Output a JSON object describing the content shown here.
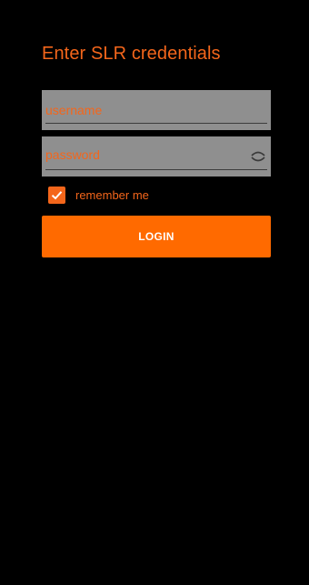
{
  "login_form": {
    "title": "Enter SLR credentials",
    "username": {
      "value": "",
      "placeholder": "username"
    },
    "password": {
      "value": "",
      "placeholder": "password",
      "toggle_icon": "eye-toggle-icon"
    },
    "remember": {
      "checked": true,
      "label": "remember me"
    },
    "login_button_label": "LOGIN"
  },
  "colors": {
    "background": "#000000",
    "accent": "#f4661b",
    "button": "#ff6a00",
    "field_background": "#8f8f8f",
    "button_text": "#ffffff"
  }
}
